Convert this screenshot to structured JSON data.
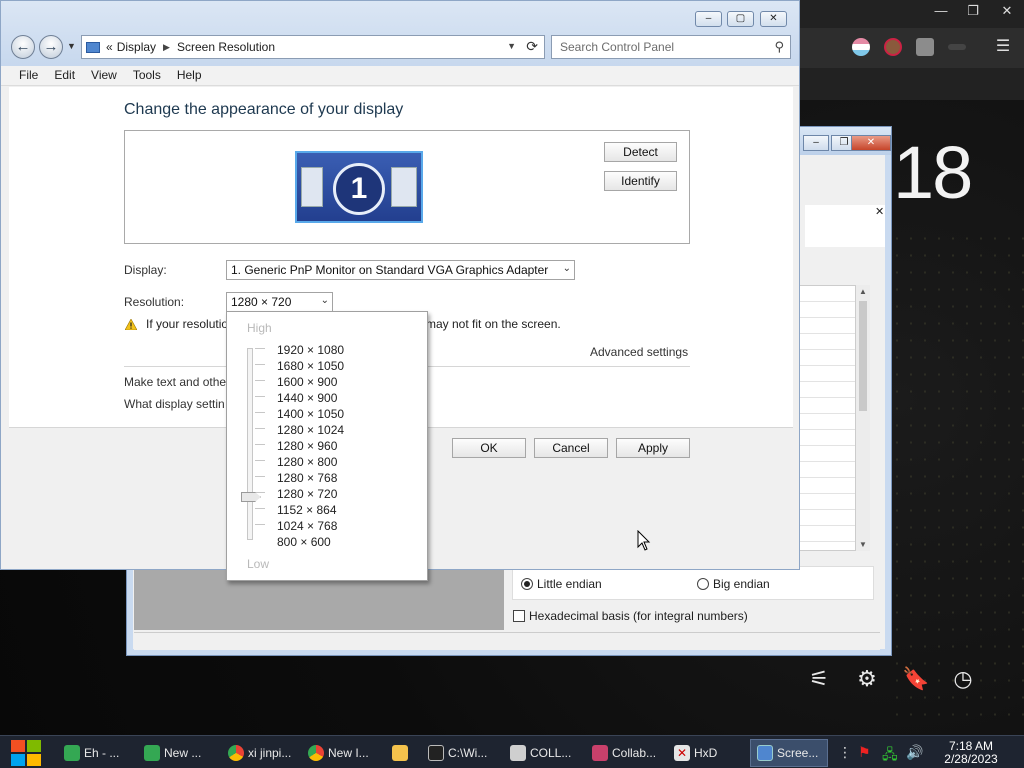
{
  "background": {
    "big_clock": "18"
  },
  "hxd": {
    "little_endian": "Little endian",
    "big_endian": "Big endian",
    "hex_basis": "Hexadecimal basis (for integral numbers)"
  },
  "window": {
    "breadcrumb": [
      "Display",
      "Screen Resolution"
    ],
    "breadcrumb_prefix": "«",
    "search_placeholder": "Search Control Panel",
    "menu": [
      "File",
      "Edit",
      "View",
      "Tools",
      "Help"
    ]
  },
  "main": {
    "heading": "Change the appearance of your display",
    "monitor_number": "1",
    "detect": "Detect",
    "identify": "Identify",
    "display_label": "Display:",
    "display_value": "1. Generic PnP Monitor on Standard VGA Graphics Adapter",
    "resolution_label": "Resolution:",
    "resolution_value": "1280 × 720",
    "warning_left": "If your resolutio",
    "warning_right": "may not fit on the screen.",
    "advanced": "Advanced settings",
    "link1": "Make text and othe",
    "link2": "What display settin",
    "ok": "OK",
    "cancel": "Cancel",
    "apply": "Apply"
  },
  "dropdown": {
    "high": "High",
    "low": "Low",
    "options": [
      "1920 × 1080",
      "1680 × 1050",
      "1600 × 900",
      "1440 × 900",
      "1400 × 1050",
      "1280 × 1024",
      "1280 × 960",
      "1280 × 800",
      "1280 × 768",
      "1280 × 720",
      "1152 × 864",
      "1024 × 768",
      "800 × 600"
    ],
    "selected_index": 9
  },
  "taskbar": {
    "items": [
      "Eh - ...",
      "New ...",
      "xi jinpi...",
      "New I...",
      "",
      "C:\\Wi...",
      "COLL...",
      "Collab...",
      "HxD",
      "Scree..."
    ],
    "time": "7:18 AM",
    "date": "2/28/2023"
  },
  "colors": {
    "accent": "#4f86cf",
    "taskbar": "#1e2430"
  }
}
